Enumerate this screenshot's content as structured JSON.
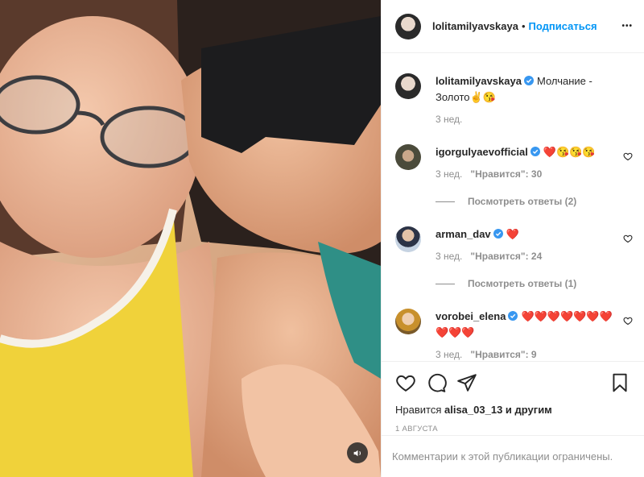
{
  "header": {
    "author": "lolitamilyavskaya",
    "separator": "•",
    "follow_label": "Подписаться",
    "more_label": "•••"
  },
  "caption": {
    "username": "lolitamilyavskaya",
    "text": "Молчание - Золото✌️😘",
    "time": "3 нед."
  },
  "comments": [
    {
      "username": "igorgulyaevofficial",
      "text": "❤️😘😘😘",
      "time": "3 нед.",
      "likes_label": "\"Нравится\": 30",
      "replies_label": "Посмотреть ответы (2)"
    },
    {
      "username": "arman_dav",
      "text": "❤️",
      "time": "3 нед.",
      "likes_label": "\"Нравится\": 24",
      "replies_label": "Посмотреть ответы (1)"
    },
    {
      "username": "vorobei_elena",
      "text": "❤️❤️❤️❤️❤️❤️❤️❤️❤️❤️",
      "time": "3 нед.",
      "likes_label": "\"Нравится\": 9"
    }
  ],
  "actions": {
    "likes_prefix": "Нравится",
    "likes_user": "alisa_03_13",
    "likes_suffix": "и другим",
    "date": "1 августа"
  },
  "footer": {
    "comments_limited": "Комментарии к этой публикации ограничены."
  },
  "colors": {
    "link_blue": "#0095f6",
    "verified_blue": "#3897f0",
    "secondary_text": "#8e8e8e",
    "primary_text": "#262626"
  }
}
